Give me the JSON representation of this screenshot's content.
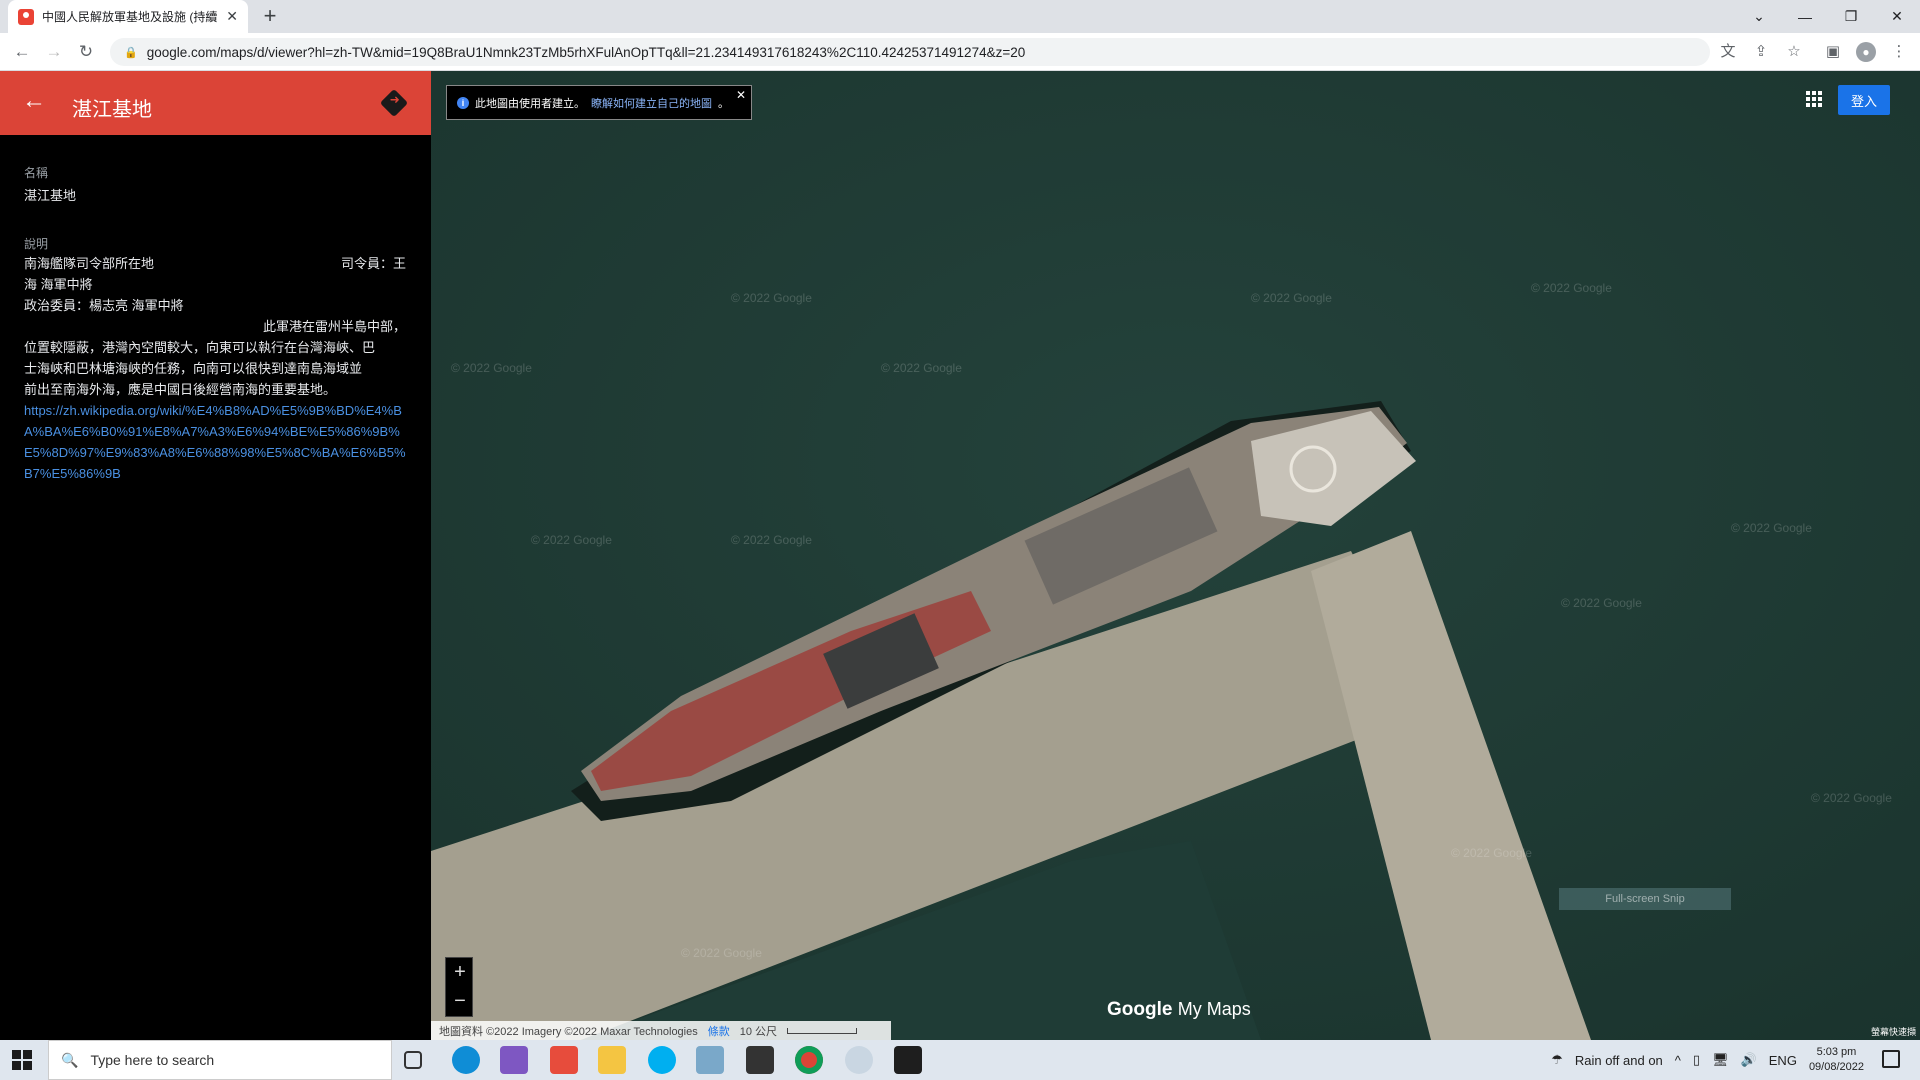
{
  "browser": {
    "tab_title": "中國人民解放軍基地及設施 (持續",
    "url": "google.com/maps/d/viewer?hl=zh-TW&mid=19Q8BraU1Nmnk23TzMb5rhXFulAnOpTTq&ll=21.234149317618243%2C110.42425371491274&z=20"
  },
  "panel": {
    "title": "湛江基地",
    "name_label": "名稱",
    "name_value": "湛江基地",
    "desc_label": "說明",
    "desc_line1_left": "南海艦隊司令部所在地",
    "desc_line1_right": "司令員：王",
    "desc_line2": "海 海軍中將",
    "desc_line3": "政治委員：楊志亮 海軍中將",
    "desc_line4": "此軍港在雷州半島中部，",
    "desc_line5": "位置較隱蔽，港灣內空間較大，向東可以執行在台灣海峽、巴",
    "desc_line6": "士海峽和巴林塘海峽的任務，向南可以很快到達南島海域並",
    "desc_line7": "前出至南海外海，應是中國日後經營南海的重要基地。",
    "wiki_link": "https://zh.wikipedia.org/wiki/%E4%B8%AD%E5%9B%BD%E4%BA%BA%E6%B0%91%E8%A7%A3%E6%94%BE%E5%86%9B%E5%8D%97%E9%83%A8%E6%88%98%E5%8C%BA%E6%B5%B7%E5%86%9B"
  },
  "map": {
    "notice_text": "此地圖由使用者建立。",
    "notice_link": "瞭解如何建立自己的地圖",
    "notice_suffix": "。",
    "signin": "登入",
    "zoom_in": "+",
    "zoom_out": "−",
    "brand_google": "Google",
    "brand_mymaps": "My Maps",
    "attribution": "地圖資料 ©2022 Imagery ©2022 Maxar Technologies",
    "terms": "條款",
    "scale": "10 公尺",
    "watermark": "© 2022 Google",
    "snip_text": "Full-screen Snip",
    "corner_text": "螢幕快速擷"
  },
  "taskbar": {
    "search_placeholder": "Type here to search",
    "weather": "Rain off and on",
    "lang": "ENG",
    "time": "5:03 pm",
    "date": "09/08/2022"
  }
}
